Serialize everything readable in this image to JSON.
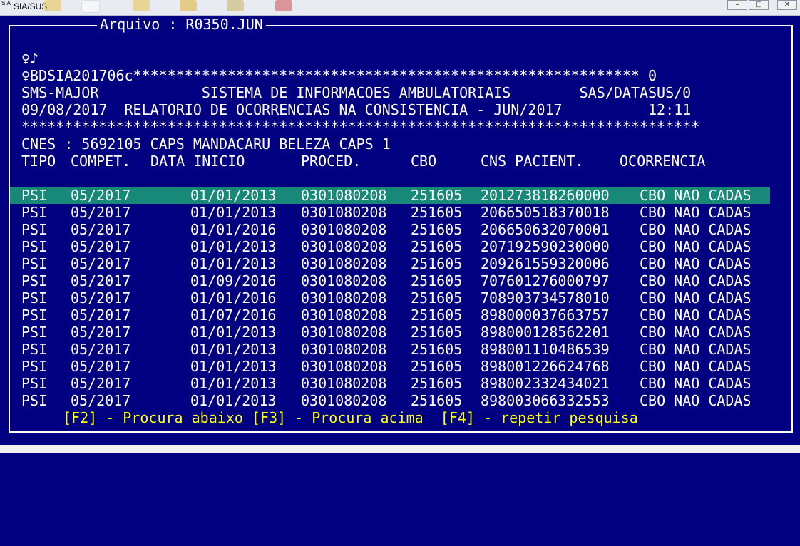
{
  "window": {
    "app_icon_text": "SIA",
    "title": "SIA/SUS"
  },
  "frame": {
    "title": "Arquivo : R0350.JUN"
  },
  "report": {
    "symbols": "♀♪",
    "db_line": "♀BDSIA201706c*********************************************************** 0",
    "header1": "SMS-MAJOR            SISTEMA DE INFORMACOES AMBULATORIAIS        SAS/DATASUS/0",
    "header2": "09/08/2017  RELATORIO DE OCORRENCIAS NA CONSISTENCIA - JUN/2017          12:11",
    "stars": "*******************************************************************************",
    "cnes": "CNES : 5692105 CAPS MANDACARU BELEZA CAPS 1",
    "columns": [
      "TIPO",
      "COMPET.",
      "DATA INICIO",
      "PROCED.",
      "CBO",
      "CNS PACIENT.",
      "OCORRENCIA"
    ]
  },
  "rows": [
    {
      "tipo": "PSI",
      "compet": "05/2017",
      "data_inicio": "01/01/2013",
      "proced": "0301080208",
      "cbo": "251605",
      "cns": "201273818260000",
      "ocorrencia": "CBO NAO CADAS"
    },
    {
      "tipo": "PSI",
      "compet": "05/2017",
      "data_inicio": "01/01/2013",
      "proced": "0301080208",
      "cbo": "251605",
      "cns": "206650518370018",
      "ocorrencia": "CBO NAO CADAS"
    },
    {
      "tipo": "PSI",
      "compet": "05/2017",
      "data_inicio": "01/01/2016",
      "proced": "0301080208",
      "cbo": "251605",
      "cns": "206650632070001",
      "ocorrencia": "CBO NAO CADAS"
    },
    {
      "tipo": "PSI",
      "compet": "05/2017",
      "data_inicio": "01/01/2013",
      "proced": "0301080208",
      "cbo": "251605",
      "cns": "207192590230000",
      "ocorrencia": "CBO NAO CADAS"
    },
    {
      "tipo": "PSI",
      "compet": "05/2017",
      "data_inicio": "01/01/2013",
      "proced": "0301080208",
      "cbo": "251605",
      "cns": "209261559320006",
      "ocorrencia": "CBO NAO CADAS"
    },
    {
      "tipo": "PSI",
      "compet": "05/2017",
      "data_inicio": "01/09/2016",
      "proced": "0301080208",
      "cbo": "251605",
      "cns": "707601276000797",
      "ocorrencia": "CBO NAO CADAS"
    },
    {
      "tipo": "PSI",
      "compet": "05/2017",
      "data_inicio": "01/01/2016",
      "proced": "0301080208",
      "cbo": "251605",
      "cns": "708903734578010",
      "ocorrencia": "CBO NAO CADAS"
    },
    {
      "tipo": "PSI",
      "compet": "05/2017",
      "data_inicio": "01/07/2016",
      "proced": "0301080208",
      "cbo": "251605",
      "cns": "898000037663757",
      "ocorrencia": "CBO NAO CADAS"
    },
    {
      "tipo": "PSI",
      "compet": "05/2017",
      "data_inicio": "01/01/2013",
      "proced": "0301080208",
      "cbo": "251605",
      "cns": "898000128562201",
      "ocorrencia": "CBO NAO CADAS"
    },
    {
      "tipo": "PSI",
      "compet": "05/2017",
      "data_inicio": "01/01/2013",
      "proced": "0301080208",
      "cbo": "251605",
      "cns": "898001110486539",
      "ocorrencia": "CBO NAO CADAS"
    },
    {
      "tipo": "PSI",
      "compet": "05/2017",
      "data_inicio": "01/01/2013",
      "proced": "0301080208",
      "cbo": "251605",
      "cns": "898001226624768",
      "ocorrencia": "CBO NAO CADAS"
    },
    {
      "tipo": "PSI",
      "compet": "05/2017",
      "data_inicio": "01/01/2013",
      "proced": "0301080208",
      "cbo": "251605",
      "cns": "898002332434021",
      "ocorrencia": "CBO NAO CADAS"
    },
    {
      "tipo": "PSI",
      "compet": "05/2017",
      "data_inicio": "01/01/2013",
      "proced": "0301080208",
      "cbo": "251605",
      "cns": "898003066332553",
      "ocorrencia": "CBO NAO CADAS"
    }
  ],
  "footer": "[F2] - Procura abaixo [F3] - Procura acima  [F4] - repetir pesquisa",
  "colors": {
    "background": "#000080",
    "selected_row": "#188878",
    "text": "#ffffff",
    "footer_text": "#ffff00"
  }
}
